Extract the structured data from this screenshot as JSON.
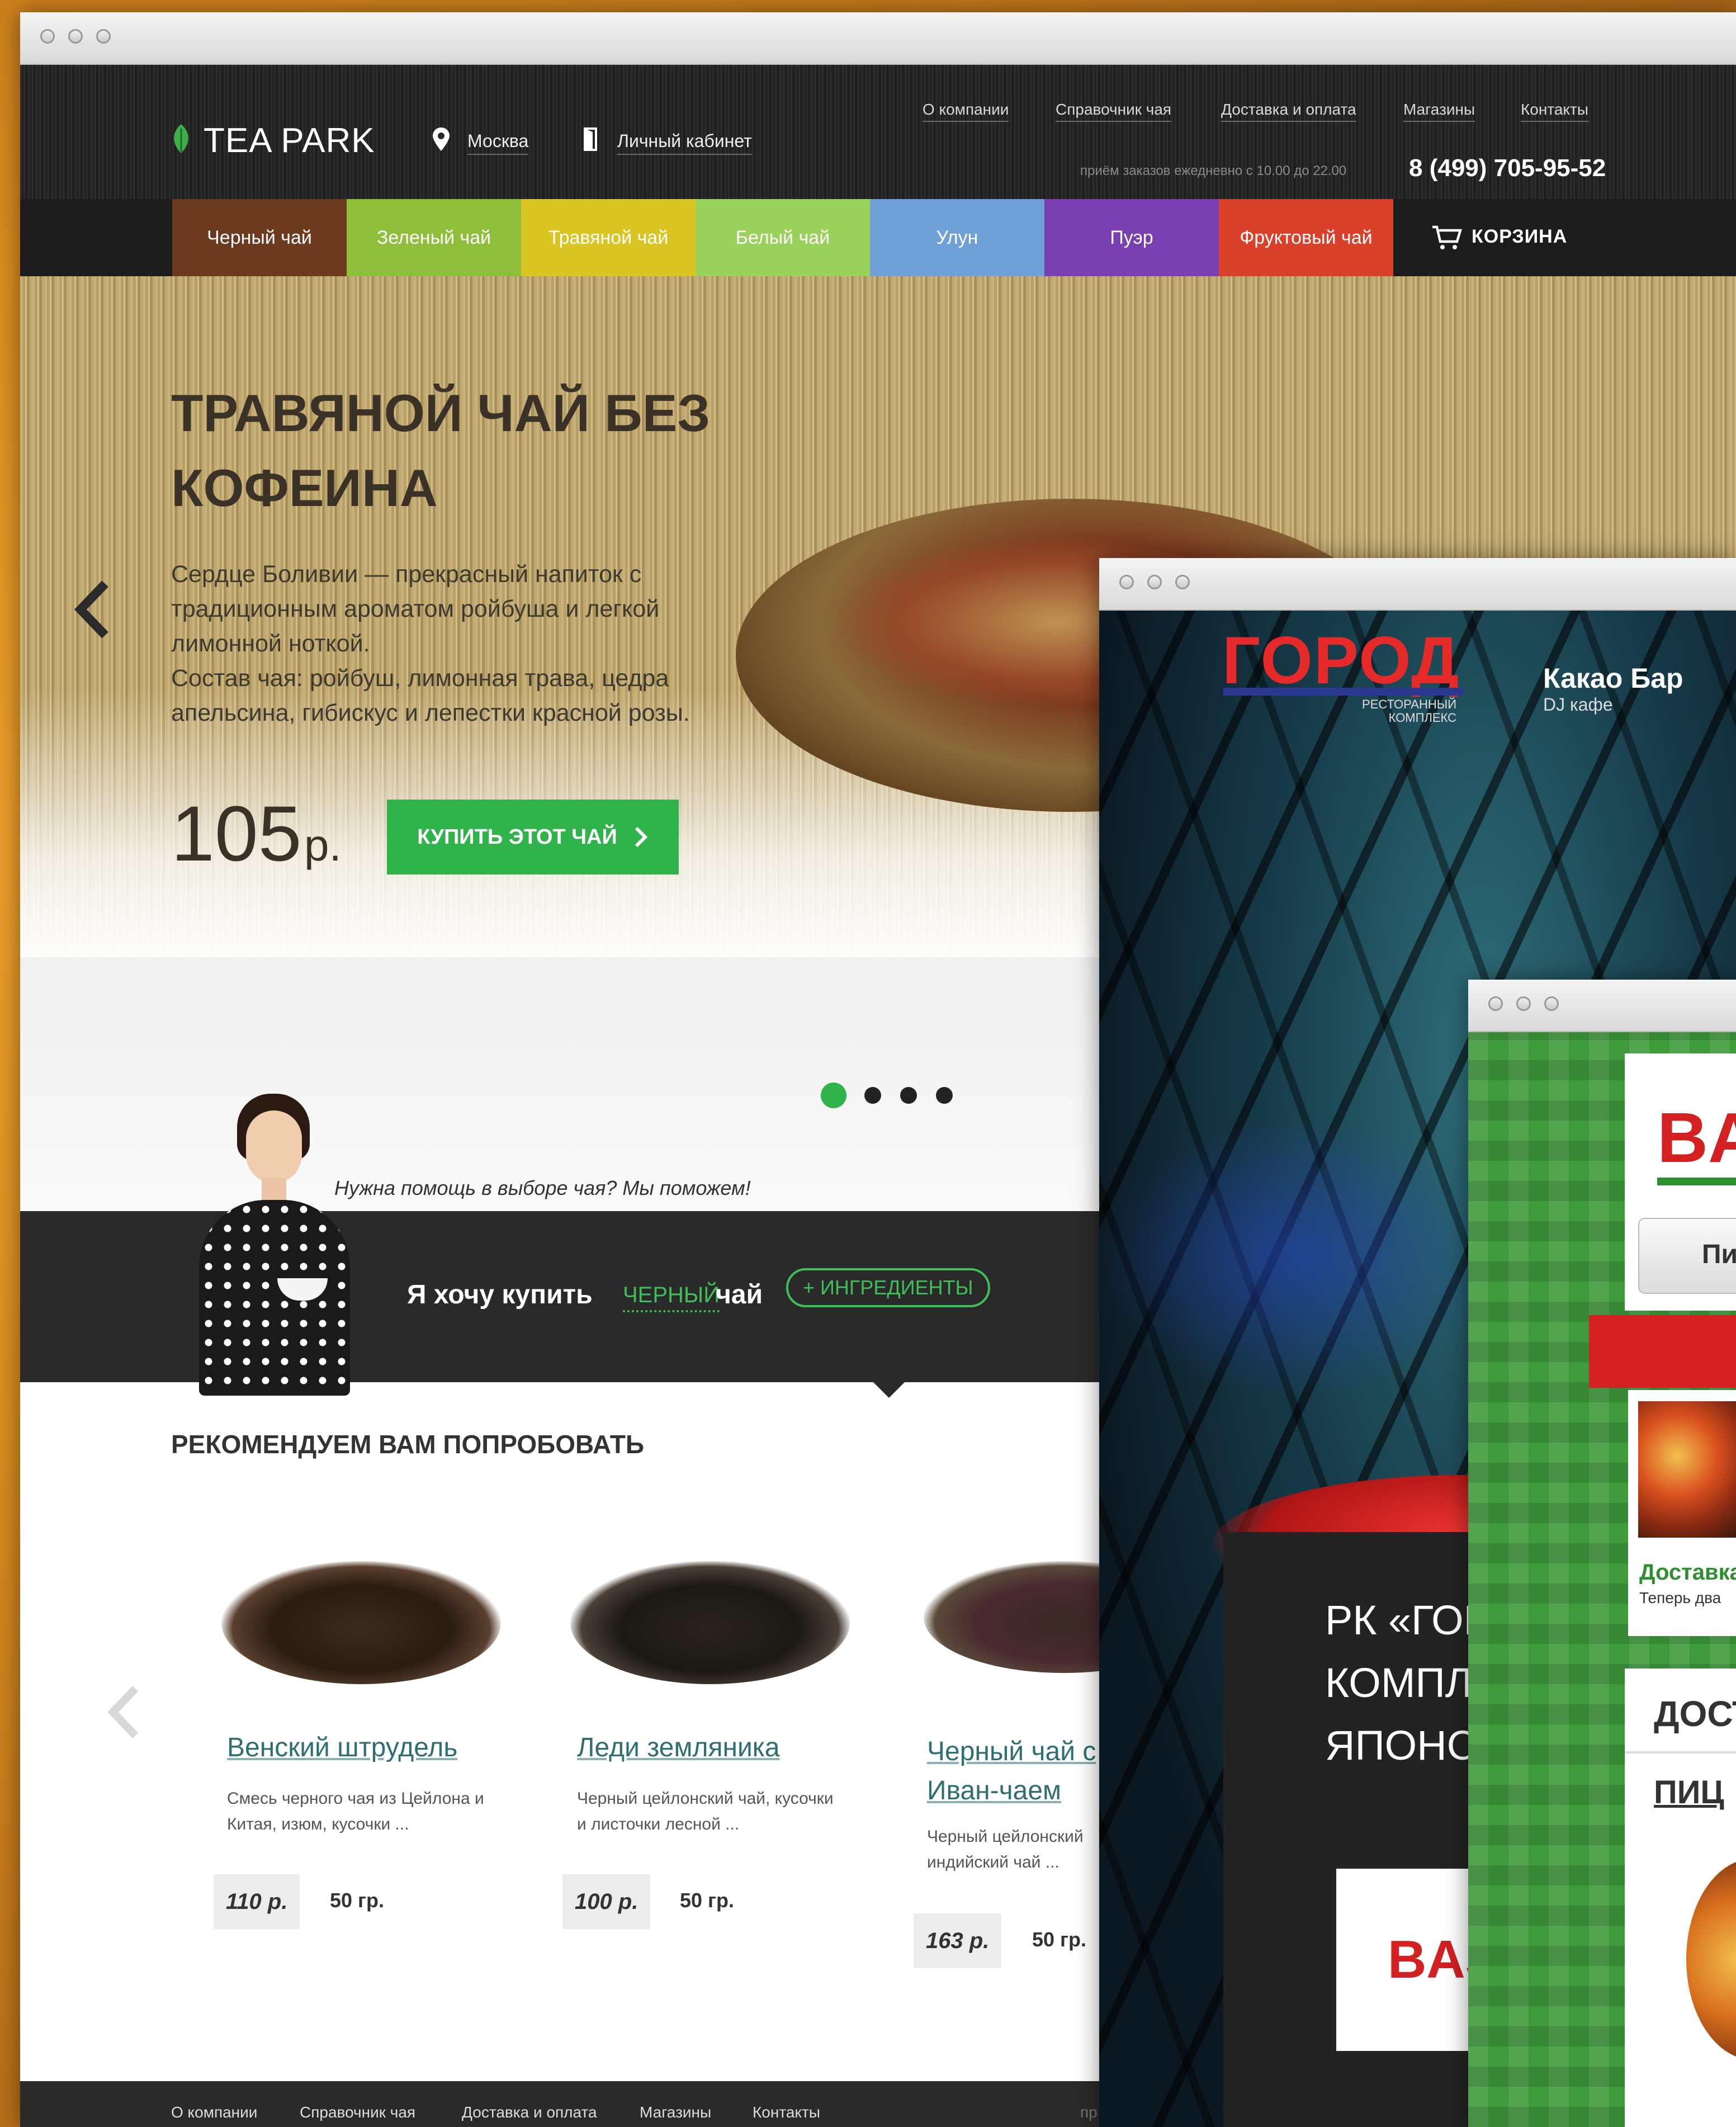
{
  "teapark": {
    "logo": "TEA PARK",
    "city": "Москва",
    "cabinet": "Личный кабинет",
    "top_nav": [
      "О компании",
      "Справочник чая",
      "Доставка и оплата",
      "Магазины",
      "Контакты"
    ],
    "hours": "приём заказов ежедневно с 10.00 до 22.00",
    "phone": "8 (499) 705-95-52",
    "categories": [
      {
        "label": "Черный чай",
        "color": "#6b3a1f"
      },
      {
        "label": "Зеленый чай",
        "color": "#8fbf3a"
      },
      {
        "label": "Травяной чай",
        "color": "#d9c422"
      },
      {
        "label": "Белый чай",
        "color": "#9ad15a"
      },
      {
        "label": "Улун",
        "color": "#6fa0d8"
      },
      {
        "label": "Пуэр",
        "color": "#7a3fb0"
      },
      {
        "label": "Фруктовый чай",
        "color": "#d9412b"
      }
    ],
    "cart": "КОРЗИНА",
    "hero": {
      "title_line1": "ТРАВЯНОЙ ЧАЙ БЕЗ",
      "title_line2": "КОФЕИНА",
      "desc_lines": [
        "Сердце Боливии — прекрасный напиток с",
        "традиционным ароматом ройбуша и легкой",
        "лимонной ноткой.",
        "Состав чая: ройбуш, лимонная трава, цедра",
        "апельсина, гибискус и лепестки красной розы."
      ],
      "price": "105",
      "currency": "р.",
      "buy_button": "КУПИТЬ ЭТОТ ЧАЙ"
    },
    "help_text": "Нужна помощь в выборе чая? Мы поможем!",
    "want_prefix": "Я хочу купить",
    "want_type": "ЧЕРНЫЙ",
    "want_suffix": "чай",
    "ingredients_button": "+ ИНГРЕДИЕНТЫ",
    "recommend_title": "РЕКОМЕНДУЕМ ВАМ ПОПРОБОВАТЬ",
    "products": [
      {
        "name_lines": [
          "Венский штрудель"
        ],
        "desc_lines": [
          "Смесь черного чая из Цейлона и",
          "Китая, изюм, кусочки ..."
        ],
        "price": "110 р.",
        "weight": "50 гр."
      },
      {
        "name_lines": [
          "Леди земляника"
        ],
        "desc_lines": [
          "Черный цейлонский чай, кусочки",
          "и листочки лесной ..."
        ],
        "price": "100 р.",
        "weight": "50 гр."
      },
      {
        "name_lines": [
          "Черный чай с",
          "Иван-чаем"
        ],
        "desc_lines": [
          "Черный цейлонский",
          "индийский чай ..."
        ],
        "price": "163 р.",
        "weight": "50 гр."
      }
    ],
    "footer_nav": [
      "О компании",
      "Справочник чая",
      "Доставка и оплата",
      "Магазины",
      "Контакты"
    ],
    "footer_extra": "пр"
  },
  "gorod": {
    "logo": "ГОРОД",
    "logo_sub_line1": "РЕСТОРАННЫЙ",
    "logo_sub_line2": "КОМПЛЕКС",
    "venue_title": "Какао Бар",
    "venue_sub": "DJ кафе",
    "promo_lines": [
      "РК «ГОРО",
      "КОМПЛЕ",
      "ЯПОНСК"
    ],
    "badge": "BAS"
  },
  "pizza": {
    "logo": "BA",
    "button": "Пи",
    "delivery_title": "Доставка",
    "delivery_sub": "Теперь два",
    "section_title": "ДОСТ",
    "section_sub": "ПИЦ"
  }
}
